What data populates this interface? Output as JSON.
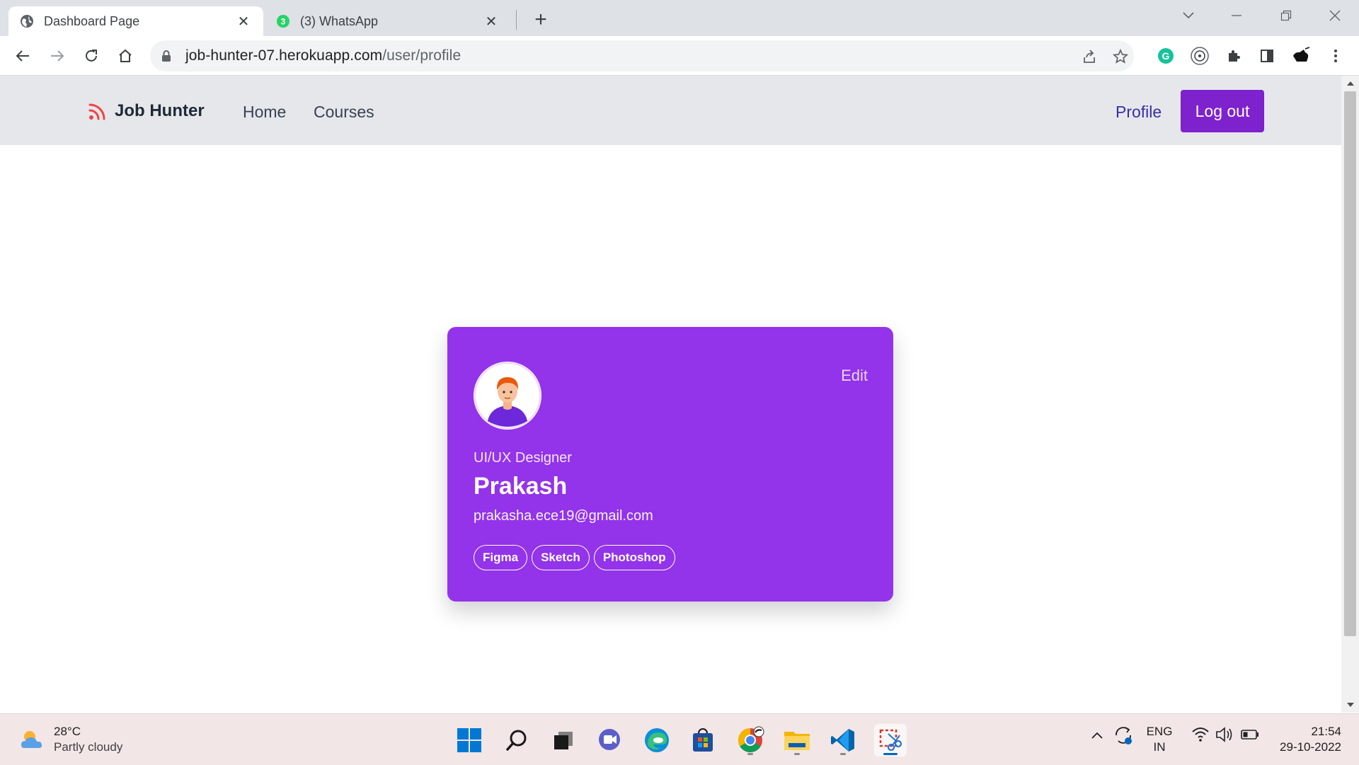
{
  "browser": {
    "tabs": [
      {
        "title": "Dashboard Page",
        "active": true,
        "favicon": "globe-icon"
      },
      {
        "title": "(3) WhatsApp",
        "active": false,
        "favicon": "whatsapp-icon",
        "badge": "3"
      }
    ],
    "url_host": "job-hunter-07.herokuapp.com",
    "url_path": "/user/profile"
  },
  "navbar": {
    "brand": "Job Hunter",
    "links": [
      "Home",
      "Courses"
    ],
    "profile": "Profile",
    "logout": "Log out"
  },
  "profile_card": {
    "edit": "Edit",
    "role": "UI/UX Designer",
    "name": "Prakash",
    "email": "prakasha.ece19@gmail.com",
    "skills": [
      "Figma",
      "Sketch",
      "Photoshop"
    ]
  },
  "taskbar": {
    "weather_temp": "28°C",
    "weather_condition": "Partly cloudy",
    "language_top": "ENG",
    "language_bottom": "IN",
    "time": "21:54",
    "date": "29-10-2022"
  },
  "colors": {
    "accent_purple": "#9333ea",
    "logout_purple": "#7e22ce",
    "navbar_bg": "#e5e7eb",
    "profile_link": "#3730a3"
  }
}
